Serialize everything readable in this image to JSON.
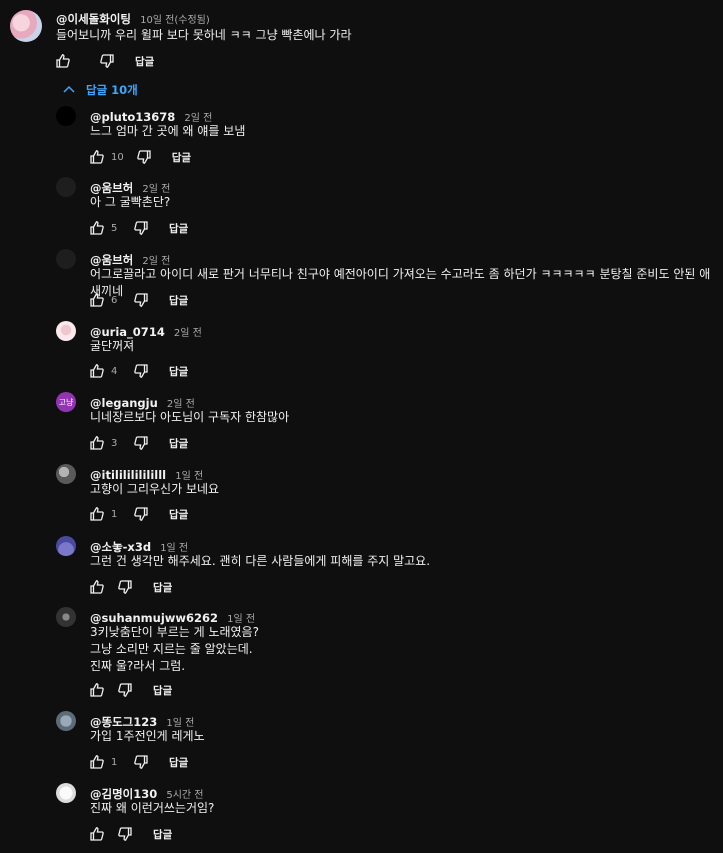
{
  "top_comment": {
    "author": "@이세돌화이팅",
    "time": "10일 전(수정됨)",
    "text": "들어보니까 우리 윌파 보다 못하네 ㅋㅋ 그냥 빡촌에나 가라",
    "likes": "",
    "reply_label": "답글"
  },
  "replies_toggle": {
    "label": "답글 10개",
    "icon": "chevron-up-icon"
  },
  "replies": [
    {
      "author": "@pluto13678",
      "time": "2일 전",
      "text": "느그 엄마 간 곳에 왜 얘를 보냄",
      "likes": "10",
      "reply_label": "답글"
    },
    {
      "author": "@움브허",
      "time": "2일 전",
      "text": "아 그 굴빡촌단?",
      "likes": "5",
      "reply_label": "답글"
    },
    {
      "author": "@움브허",
      "time": "2일 전",
      "text": "어그로끌라고 아이디 새로 판거 너무티나 친구야 예전아이디 가져오는 수고라도 좀 하던가 ㅋㅋㅋㅋㅋ 분탕칠 준비도 안된 애새끼네",
      "likes": "6",
      "reply_label": "답글"
    },
    {
      "author": "@uria_0714",
      "time": "2일 전",
      "text": "굴단꺼져",
      "likes": "4",
      "reply_label": "답글"
    },
    {
      "author": "@legangju",
      "time": "2일 전",
      "avatar_text": "고냥",
      "text": "니네장르보다 아도님이 구독자 한참많아",
      "likes": "3",
      "reply_label": "답글"
    },
    {
      "author": "@itililililililll",
      "time": "1일 전",
      "text": "고향이 그리우신가 보네요",
      "likes": "1",
      "reply_label": "답글"
    },
    {
      "author": "@소놓-x3d",
      "time": "1일 전",
      "text": "그런 건 생각만 해주세요. 괜히 다른 사람들에게 피해를 주지 말고요.",
      "likes": "",
      "reply_label": "답글"
    },
    {
      "author": "@suhanmujww6262",
      "time": "1일 전",
      "text": "3키낮춤단이 부르는 게 노래였음?\n그냥 소리만 지르는 줄 알았는데.\n진짜 울?라서 그럼.",
      "likes": "",
      "reply_label": "답글"
    },
    {
      "author": "@똥도그123",
      "time": "1일 전",
      "text": "가입 1주전인게 레게노",
      "likes": "1",
      "reply_label": "답글"
    },
    {
      "author": "@김명이130",
      "time": "5시간 전",
      "text": "진짜 왜 이런거쓰는거임?",
      "likes": "",
      "reply_label": "답글"
    }
  ],
  "colors": {
    "background": "#0f0f0f",
    "text": "#f1f1f1",
    "muted": "#aaaaaa",
    "link": "#3ea6ff"
  }
}
